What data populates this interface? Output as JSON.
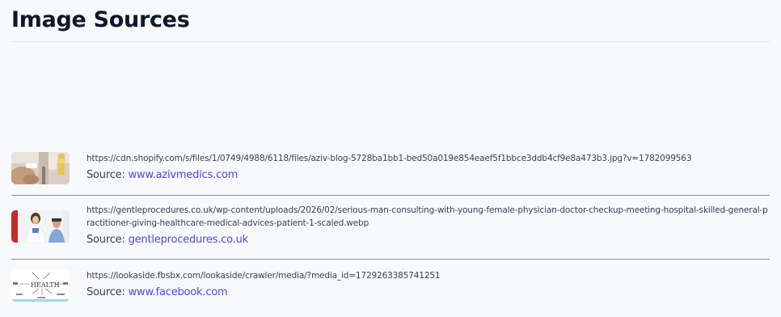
{
  "page": {
    "title": "Image Sources"
  },
  "sources": [
    {
      "url": "https://cdn.shopify.com/s/files/1/0749/4988/6118/files/aziv-blog-5728ba1bb1-bed50a019e854eaef5f1bbce3ddb4cf9e8a473b3.jpg?v=1782099563",
      "source_label": "Source:",
      "source_link": "www.azivmedics.com",
      "thumb_icon": "clinic-photo-thumbnail"
    },
    {
      "url": "https://gentleprocedures.co.uk/wp-content/uploads/2026/02/serious-man-consulting-with-young-female-physician-doctor-checkup-meeting-hospital-skilled-general-practitioner-giving-healthcare-medical-advices-patient-1-scaled.webp",
      "source_label": "Source:",
      "source_link": "gentleprocedures.co.uk",
      "thumb_icon": "doctor-consultation-thumbnail"
    },
    {
      "url": "https://lookaside.fbsbx.com/lookaside/crawler/media/?media_id=1729263385741251",
      "source_label": "Source:",
      "source_link": "www.facebook.com",
      "thumb_icon": "health-diagram-thumbnail"
    }
  ]
}
